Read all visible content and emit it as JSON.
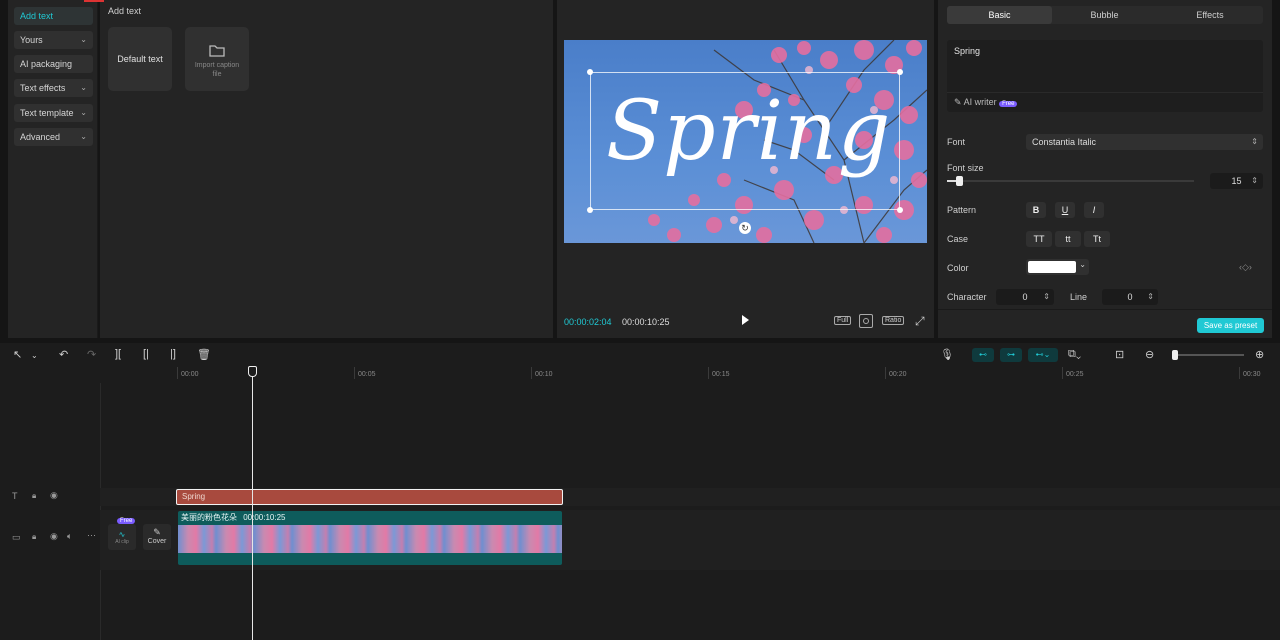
{
  "left": {
    "categories": [
      {
        "label": "Add text",
        "active": true,
        "chevron": false
      },
      {
        "label": "Yours",
        "active": false,
        "chevron": true
      },
      {
        "label": "AI packaging",
        "active": false,
        "chevron": false
      },
      {
        "label": "Text effects",
        "active": false,
        "chevron": true
      },
      {
        "label": "Text template",
        "active": false,
        "chevron": true
      },
      {
        "label": "Advanced",
        "active": false,
        "chevron": true
      }
    ],
    "section_title": "Add text",
    "default_text": "Default text",
    "import_caption": "Import caption file"
  },
  "player": {
    "overlay_text": "Spring",
    "current_time": "00:00:02:04",
    "total_time": "00:00:10:25",
    "full_label": "Full",
    "ratio_label": "Ratio"
  },
  "inspector": {
    "tabs": [
      "Basic",
      "Bubble",
      "Effects"
    ],
    "active_tab": "Basic",
    "text_value": "Spring",
    "ai_writer": "AI writer",
    "free_badge": "Free",
    "font_label": "Font",
    "font_value": "Constantia Italic",
    "font_size_label": "Font size",
    "font_size_value": "15",
    "font_size_slider": 0.05,
    "pattern_label": "Pattern",
    "pattern_buttons": [
      "B",
      "U",
      "I"
    ],
    "case_label": "Case",
    "case_buttons": [
      "TT",
      "tt",
      "Tt"
    ],
    "color_label": "Color",
    "color_value": "#ffffff",
    "character_label": "Character",
    "character_value": "0",
    "line_label": "Line",
    "line_value": "0",
    "save_preset": "Save as preset"
  },
  "timeline": {
    "ruler_labels": [
      "00:00",
      "00:05",
      "00:10",
      "00:15",
      "00:20",
      "00:25",
      "00:30"
    ],
    "text_clip_label": "Spring",
    "video_clip_label": "美丽的粉色花朵",
    "video_clip_duration": "00:00:10:25",
    "cover_label": "Cover",
    "free_badge": "Free",
    "audio_thumb_label": "AI clip"
  },
  "colors": {
    "accent": "#20c9d4",
    "text_clip": "#a84a3e",
    "video_clip": "#0e5c5c"
  }
}
